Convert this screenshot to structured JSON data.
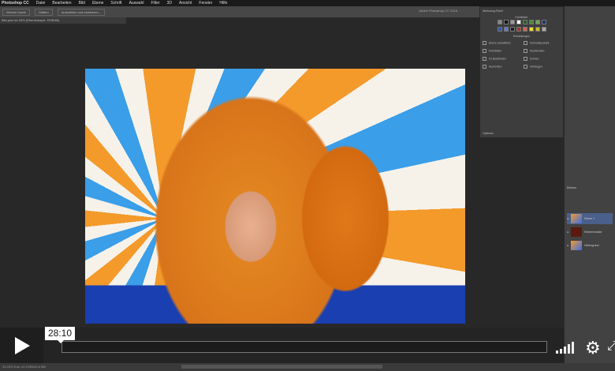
{
  "menubar": {
    "items": [
      "Photoshop CC",
      "Datei",
      "Bearbeiten",
      "Bild",
      "Ebene",
      "Schrift",
      "Auswahl",
      "Filter",
      "3D",
      "Ansicht",
      "Fenster",
      "Hilfe"
    ]
  },
  "optbar": {
    "buttons": [
      "Weiche Kante",
      "Glätten",
      "Auswählen und maskieren..."
    ]
  },
  "app_title": "Adobe Photoshop CC 2018",
  "document_tab": "Bild.psd bei 33% (Ebenenkopie, RGB/8#)",
  "panel1": {
    "title": "Werkzeug-Panel",
    "section1": "Farbfelder",
    "section2": "Einstellungen",
    "options": [
      "Ebene auswählen",
      "Schnellauswahl",
      "Freistellen",
      "Ausblenden",
      "Im Bearbeiten",
      "Drehen",
      "Ausrichten",
      "Verbiegen"
    ],
    "footer": "Optionen"
  },
  "panel2": {
    "title": "Ebenen",
    "layers": [
      "Ebene 1",
      "Ebenenmaske",
      "Hintergrund"
    ]
  },
  "colors": {
    "swatches": [
      "#888",
      "#111",
      "#999",
      "#fff",
      "#2a5a2a",
      "#4a8a3a",
      "#7aa05a",
      "#223366",
      "#3355aa",
      "#6677cc",
      "#222",
      "#aa3322",
      "#cc6655",
      "#eedd33",
      "#ccbb22",
      "#aaa"
    ]
  },
  "player": {
    "timestamp": "28:10",
    "progress": 0,
    "icons": [
      "play-icon",
      "volume-icon",
      "gear-icon",
      "fullscreen-icon"
    ]
  },
  "status": "33,33%  Dok: 24,9 MB/49,8 MB"
}
